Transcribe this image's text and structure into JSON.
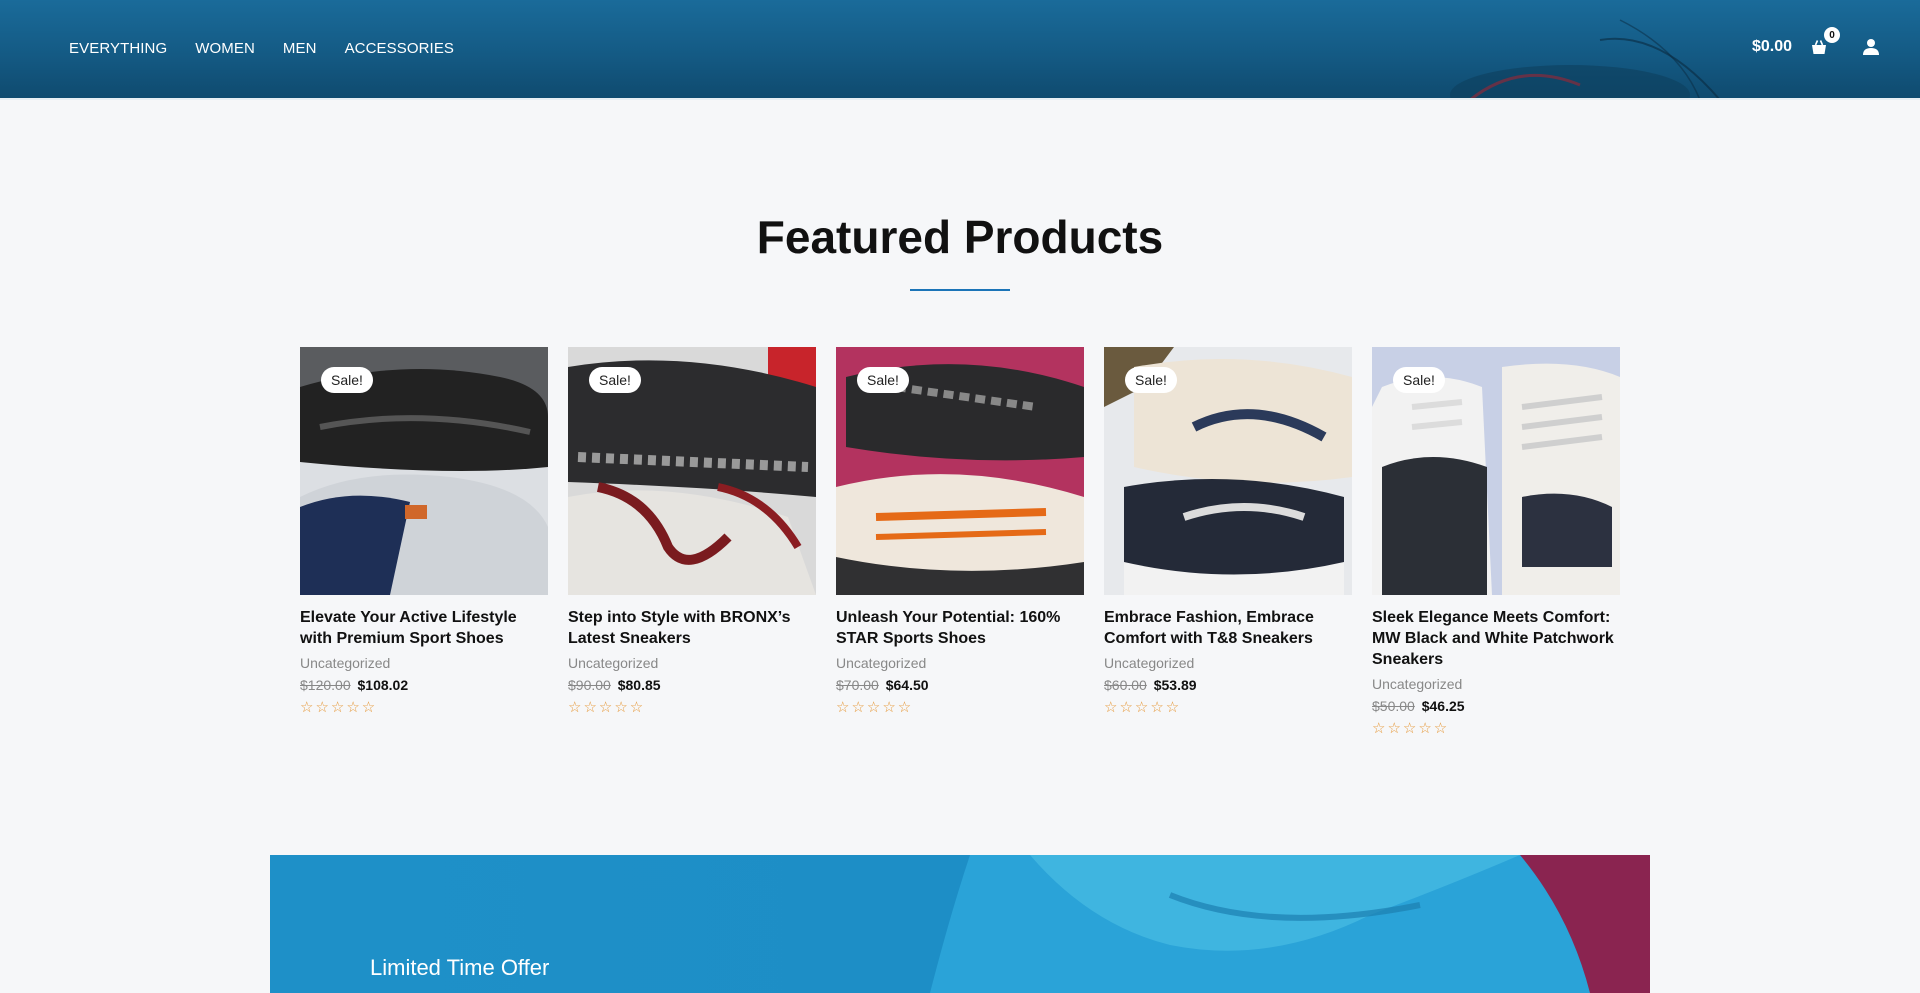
{
  "header": {
    "nav": [
      "EVERYTHING",
      "WOMEN",
      "MEN",
      "ACCESSORIES"
    ],
    "cart_total": "$0.00",
    "cart_count": "0",
    "icons": [
      "shopping-bag-icon",
      "user-icon"
    ]
  },
  "featured": {
    "title": "Featured Products"
  },
  "products": [
    {
      "badge": "Sale!",
      "title": "Elevate Your Active Lifestyle with Premium Sport Shoes",
      "category": "Uncategorized",
      "old_price": "$120.00",
      "price": "$108.02",
      "rating": 0
    },
    {
      "badge": "Sale!",
      "title": "Step into Style with BRONX’s Latest Sneakers",
      "category": "Uncategorized",
      "old_price": "$90.00",
      "price": "$80.85",
      "rating": 0
    },
    {
      "badge": "Sale!",
      "title": "Unleash Your Potential: 160% STAR Sports Shoes",
      "category": "Uncategorized",
      "old_price": "$70.00",
      "price": "$64.50",
      "rating": 0
    },
    {
      "badge": "Sale!",
      "title": "Embrace Fashion, Embrace Comfort with T&8 Sneakers",
      "category": "Uncategorized",
      "old_price": "$60.00",
      "price": "$53.89",
      "rating": 0
    },
    {
      "badge": "Sale!",
      "title": "Sleek Elegance Meets Comfort: MW Black and White Patchwork Sneakers",
      "category": "Uncategorized",
      "old_price": "$50.00",
      "price": "$46.25",
      "rating": 0
    }
  ],
  "banner": {
    "title": "Limited Time Offer"
  },
  "colors": {
    "header": "#145a84",
    "accent": "#1b74b8",
    "star": "#e69a3c",
    "banner": "#1e90c8"
  }
}
